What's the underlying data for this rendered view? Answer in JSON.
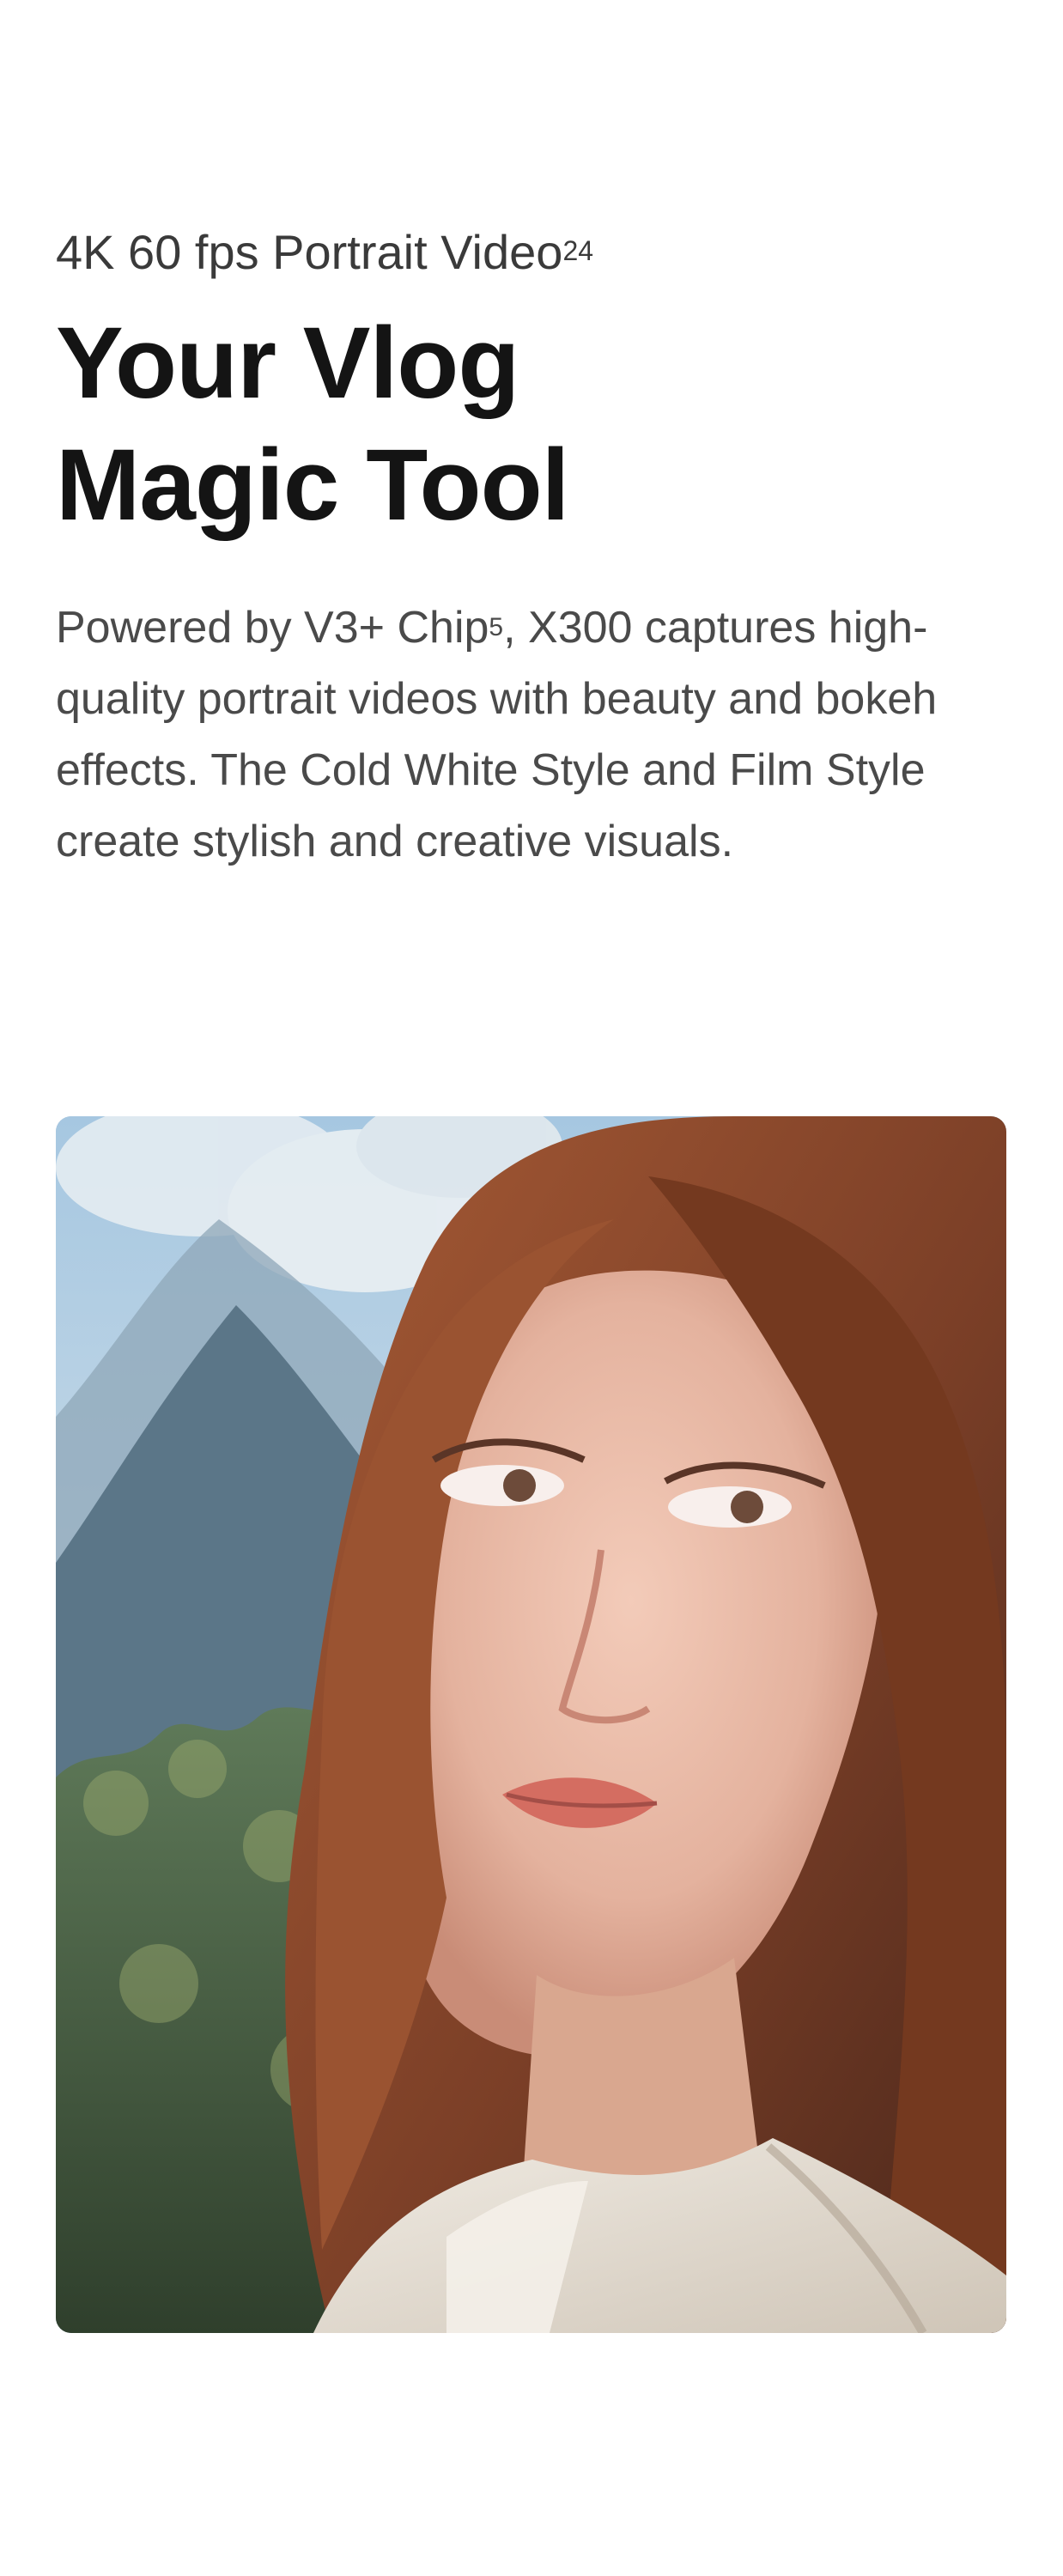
{
  "feature": {
    "eyebrow": "4K 60 fps Portrait Video",
    "eyebrow_footnote": "24",
    "headline_line1": "Your Vlog",
    "headline_line2": "Magic Tool",
    "body_before_footnote": "Powered by V3+ Chip",
    "body_footnote": "5",
    "body_after_footnote": ", X300 captures high-quality portrait videos with beauty and bokeh effects. The Cold White Style and Film Style create stylish and creative visuals."
  },
  "photo": {
    "subject": "portrait-photo",
    "colors": {
      "sky": "#9fc0dc",
      "mountain": "#5f7d92",
      "forest": "#41573c",
      "hair": "#8a4a2d",
      "skin": "#e7b8a3",
      "jacket": "#e3ddd2"
    }
  }
}
